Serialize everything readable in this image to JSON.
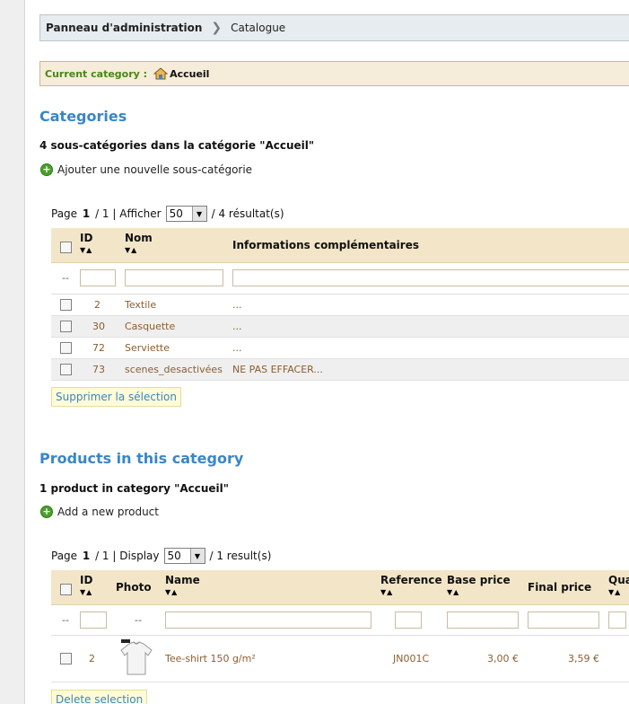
{
  "breadcrumb": {
    "root": "Panneau d'administration",
    "current": "Catalogue"
  },
  "current_category": {
    "label": "Current category :",
    "value": "Accueil"
  },
  "categories": {
    "title": "Categories",
    "count_text": "4 sous-catégories dans la catégorie \"Accueil\"",
    "add_link": "Ajouter une nouvelle sous-catégorie",
    "pager": {
      "page_word": "Page",
      "page": "1",
      "total": "/ 1 |",
      "display_word": "Afficher",
      "per_page": "50",
      "results": "/ 4 résultat(s)"
    },
    "columns": {
      "id": "ID",
      "name": "Nom",
      "info": "Informations complémentaires"
    },
    "filter_dash": "--",
    "rows": [
      {
        "id": "2",
        "name": "Textile",
        "info": "..."
      },
      {
        "id": "30",
        "name": "Casquette",
        "info": "..."
      },
      {
        "id": "72",
        "name": "Serviette",
        "info": "..."
      },
      {
        "id": "73",
        "name": "scenes_desactivées",
        "info": "NE PAS EFFACER..."
      }
    ],
    "delete_button": "Supprimer la sélection"
  },
  "products": {
    "title": "Products in this category",
    "count_text": "1 product in category \"Accueil\"",
    "add_link": "Add a new product",
    "pager": {
      "page_word": "Page",
      "page": "1",
      "total": "/ 1 |",
      "display_word": "Display",
      "per_page": "50",
      "results": "/ 1 result(s)"
    },
    "columns": {
      "id": "ID",
      "photo": "Photo",
      "name": "Name",
      "reference": "Reference",
      "base_price": "Base price",
      "final_price": "Final price",
      "quantity": "Qua"
    },
    "filter_dash": "--",
    "photo_dash": "--",
    "rows": [
      {
        "id": "2",
        "name": "Tee-shirt 150 g/m²",
        "reference": "JN001C",
        "base_price": "3,00 €",
        "final_price": "3,59 €"
      }
    ],
    "delete_button": "Delete selection"
  },
  "icons": {
    "sort": "sort-arrows-icon",
    "home": "home-icon",
    "add": "add-icon",
    "breadcrumb_sep": "chevron-right-icon"
  },
  "colors": {
    "section_title": "#3a86c6",
    "current_label": "#478813",
    "row_text": "#8b5e2f",
    "header_bg": "#f3e6c8"
  }
}
